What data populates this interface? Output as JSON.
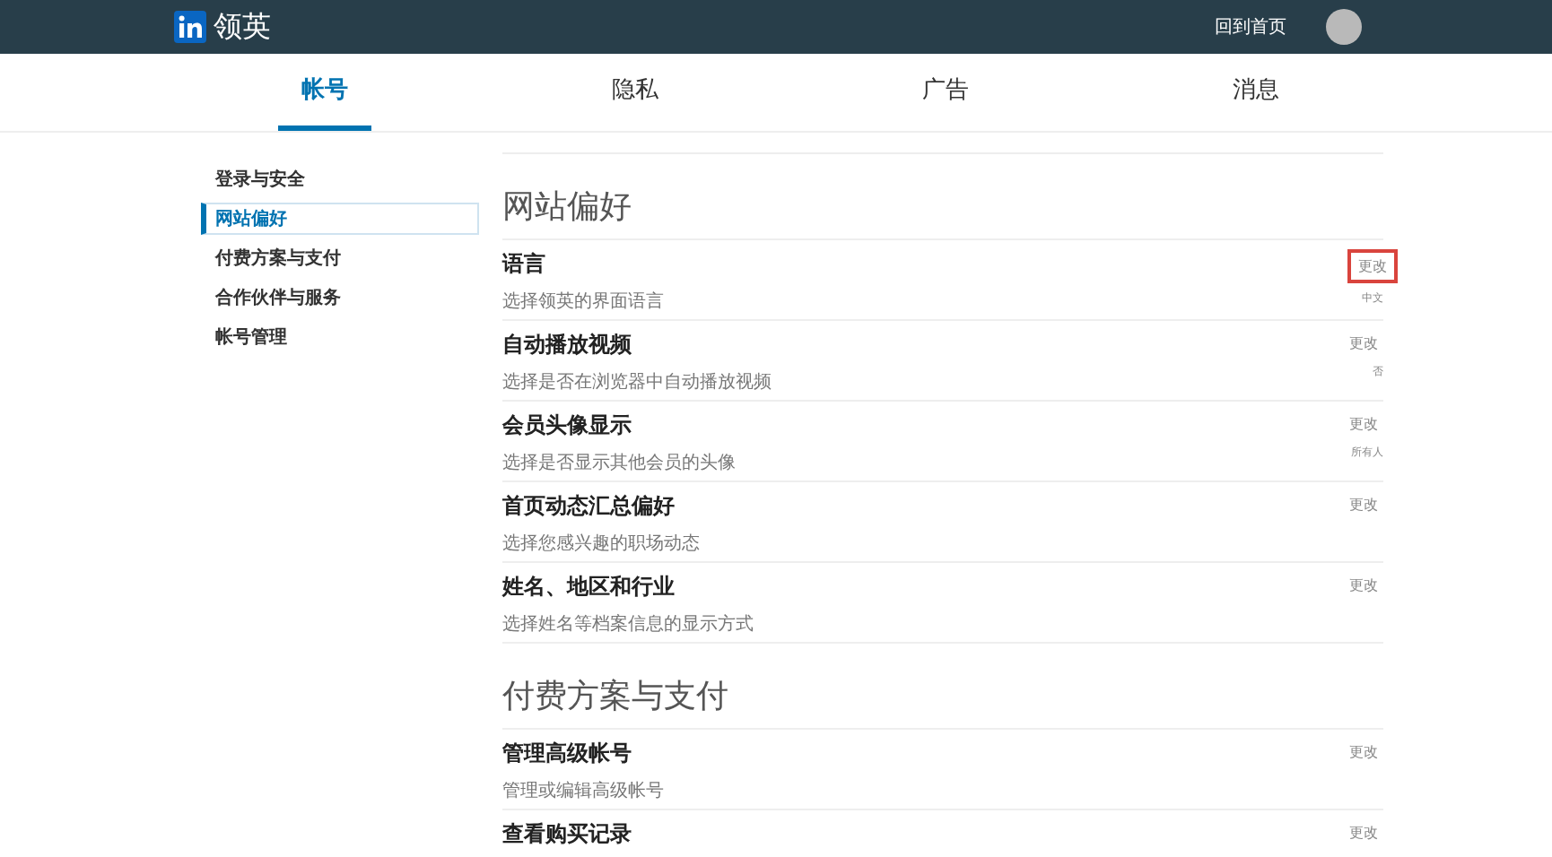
{
  "topbar": {
    "logo_text": "领英",
    "home_link": "回到首页"
  },
  "tabs": [
    {
      "label": "帐号",
      "selected": true
    },
    {
      "label": "隐私",
      "selected": false
    },
    {
      "label": "广告",
      "selected": false
    },
    {
      "label": "消息",
      "selected": false
    }
  ],
  "sidebar": {
    "items": [
      {
        "label": "登录与安全",
        "selected": false
      },
      {
        "label": "网站偏好",
        "selected": true
      },
      {
        "label": "付费方案与支付",
        "selected": false
      },
      {
        "label": "合作伙伴与服务",
        "selected": false
      },
      {
        "label": "帐号管理",
        "selected": false
      }
    ]
  },
  "sections": [
    {
      "heading": "网站偏好",
      "rows": [
        {
          "title": "语言",
          "subtitle": "选择领英的界面语言",
          "action": "更改",
          "value": "中文",
          "highlighted": true
        },
        {
          "title": "自动播放视频",
          "subtitle": "选择是否在浏览器中自动播放视频",
          "action": "更改",
          "value": "否",
          "highlighted": false
        },
        {
          "title": "会员头像显示",
          "subtitle": "选择是否显示其他会员的头像",
          "action": "更改",
          "value": "所有人",
          "highlighted": false
        },
        {
          "title": "首页动态汇总偏好",
          "subtitle": "选择您感兴趣的职场动态",
          "action": "更改",
          "highlighted": false
        },
        {
          "title": "姓名、地区和行业",
          "subtitle": "选择姓名等档案信息的显示方式",
          "action": "更改",
          "highlighted": false
        }
      ]
    },
    {
      "heading": "付费方案与支付",
      "rows": [
        {
          "title": "管理高级帐号",
          "subtitle": "管理或编辑高级帐号",
          "action": "更改",
          "highlighted": false
        },
        {
          "title": "查看购买记录",
          "action": "更改",
          "highlighted": false
        }
      ]
    }
  ]
}
